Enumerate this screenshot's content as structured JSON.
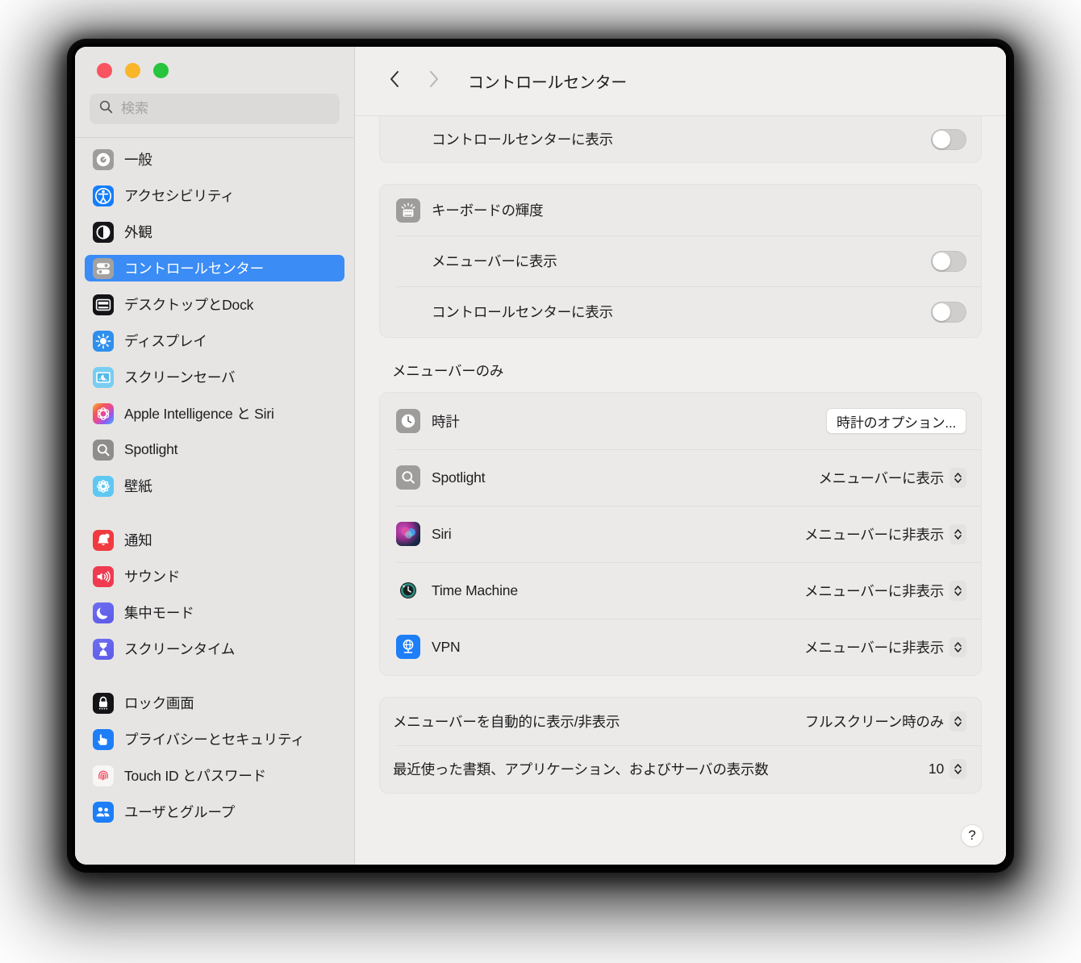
{
  "window": {
    "traffic_lights": [
      {
        "name": "close",
        "color": "#f9545f"
      },
      {
        "name": "minimize",
        "color": "#f9b62b"
      },
      {
        "name": "zoom",
        "color": "#26c53d"
      }
    ]
  },
  "search": {
    "placeholder": "検索",
    "value": "",
    "icon": "search-icon"
  },
  "sidebar": {
    "groups": [
      {
        "items": [
          {
            "label": "一般",
            "icon": "gear-icon",
            "selected": false
          },
          {
            "label": "アクセシビリティ",
            "icon": "accessibility-icon",
            "selected": false
          },
          {
            "label": "外観",
            "icon": "appearance-icon",
            "selected": false
          },
          {
            "label": "コントロールセンター",
            "icon": "control-center-icon",
            "selected": true
          },
          {
            "label": "デスクトップとDock",
            "icon": "desktop-dock-icon",
            "selected": false
          },
          {
            "label": "ディスプレイ",
            "icon": "display-icon",
            "selected": false
          },
          {
            "label": "スクリーンセーバ",
            "icon": "screen-saver-icon",
            "selected": false
          },
          {
            "label": "Apple Intelligence と Siri",
            "icon": "apple-intelligence-icon",
            "selected": false
          },
          {
            "label": "Spotlight",
            "icon": "spotlight-icon",
            "selected": false
          },
          {
            "label": "壁紙",
            "icon": "wallpaper-icon",
            "selected": false
          }
        ]
      },
      {
        "items": [
          {
            "label": "通知",
            "icon": "notifications-icon",
            "selected": false
          },
          {
            "label": "サウンド",
            "icon": "sound-icon",
            "selected": false
          },
          {
            "label": "集中モード",
            "icon": "focus-icon",
            "selected": false
          },
          {
            "label": "スクリーンタイム",
            "icon": "screen-time-icon",
            "selected": false
          }
        ]
      },
      {
        "items": [
          {
            "label": "ロック画面",
            "icon": "lock-screen-icon",
            "selected": false
          },
          {
            "label": "プライバシーとセキュリティ",
            "icon": "privacy-security-icon",
            "selected": false
          },
          {
            "label": "Touch ID とパスワード",
            "icon": "touch-id-icon",
            "selected": false
          },
          {
            "label": "ユーザとグループ",
            "icon": "users-groups-icon",
            "selected": false
          }
        ]
      }
    ]
  },
  "toolbar": {
    "back_icon": "chevron-left-icon",
    "forward_icon": "chevron-right-icon",
    "title": "コントロールセンター"
  },
  "main": {
    "clipped_card": {
      "rows": [
        {
          "label": "コントロールセンターに表示",
          "control": "toggle",
          "value": "off"
        }
      ]
    },
    "keyboard_brightness_card": {
      "header": {
        "label": "キーボードの輝度",
        "icon": "keyboard-brightness-icon"
      },
      "rows": [
        {
          "label": "メニューバーに表示",
          "control": "toggle",
          "value": "off"
        },
        {
          "label": "コントロールセンターに表示",
          "control": "toggle",
          "value": "off"
        }
      ]
    },
    "menu_bar_only": {
      "title": "メニューバーのみ",
      "rows": [
        {
          "label": "時計",
          "icon": "clock-icon",
          "control": "button",
          "value": "時計のオプション..."
        },
        {
          "label": "Spotlight",
          "icon": "spotlight-icon",
          "control": "popup",
          "value": "メニューバーに表示"
        },
        {
          "label": "Siri",
          "icon": "siri-icon",
          "control": "popup",
          "value": "メニューバーに非表示"
        },
        {
          "label": "Time Machine",
          "icon": "time-machine-icon",
          "control": "popup",
          "value": "メニューバーに非表示"
        },
        {
          "label": "VPN",
          "icon": "vpn-icon",
          "control": "popup",
          "value": "メニューバーに非表示"
        }
      ]
    },
    "bottom_card": {
      "rows": [
        {
          "label": "メニューバーを自動的に表示/非表示",
          "control": "popup",
          "value": "フルスクリーン時のみ"
        },
        {
          "label": "最近使った書類、アプリケーション、およびサーバの表示数",
          "control": "stepper",
          "value": "10"
        }
      ]
    },
    "help_button": {
      "label": "?",
      "icon": "help-icon"
    }
  },
  "colors": {
    "accent": "#3b8cf5",
    "window_bg": "#f0efed",
    "sidebar_bg": "#e6e5e3",
    "card_bg": "#eceae8"
  }
}
